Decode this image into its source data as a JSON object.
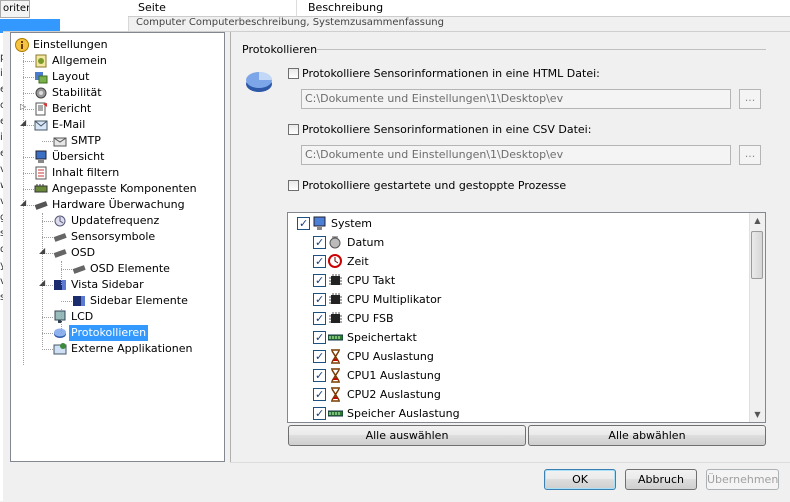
{
  "background": {
    "tab_label": "oriten",
    "columns": [
      "Seite",
      "Beschreibung"
    ],
    "row_text": "Computer                          Computerbeschreibung, Systemzusammenfassung",
    "letters": [
      "p",
      "i",
      "e",
      "c",
      "e",
      "i",
      "e",
      "v",
      "w",
      "v",
      "g",
      "s",
      "d",
      "y",
      "v",
      "s"
    ]
  },
  "tree": [
    {
      "label": "Einstellungen",
      "icon": "info-icon",
      "level": 0
    },
    {
      "label": "Allgemein",
      "icon": "general-settings-icon",
      "level": 1
    },
    {
      "label": "Layout",
      "icon": "layout-icon",
      "level": 1
    },
    {
      "label": "Stabilität",
      "icon": "stability-icon",
      "level": 1
    },
    {
      "label": "Bericht",
      "icon": "report-icon",
      "level": 1
    },
    {
      "label": "E-Mail",
      "icon": "email-icon",
      "level": 1
    },
    {
      "label": "SMTP",
      "icon": "smtp-icon",
      "level": 2
    },
    {
      "label": "Übersicht",
      "icon": "overview-icon",
      "level": 1
    },
    {
      "label": "Inhalt filtern",
      "icon": "filter-icon",
      "level": 1
    },
    {
      "label": "Angepasste Komponenten",
      "icon": "components-icon",
      "level": 1
    },
    {
      "label": "Hardware Überwachung",
      "icon": "hardware-icon",
      "level": 1
    },
    {
      "label": "Updatefrequenz",
      "icon": "update-frequency-icon",
      "level": 2
    },
    {
      "label": "Sensorsymbole",
      "icon": "sensor-icon",
      "level": 2
    },
    {
      "label": "OSD",
      "icon": "osd-icon",
      "level": 2
    },
    {
      "label": "OSD Elemente",
      "icon": "osd-elements-icon",
      "level": 3
    },
    {
      "label": "Vista Sidebar",
      "icon": "vista-sidebar-icon",
      "level": 2
    },
    {
      "label": "Sidebar Elemente",
      "icon": "sidebar-elements-icon",
      "level": 3
    },
    {
      "label": "LCD",
      "icon": "lcd-icon",
      "level": 2
    },
    {
      "label": "Protokollieren",
      "icon": "logging-icon",
      "level": 2,
      "selected": true
    },
    {
      "label": "Externe Applikationen",
      "icon": "external-apps-icon",
      "level": 2
    }
  ],
  "panel": {
    "title": "Protokollieren",
    "html_option": {
      "label": "Protokolliere Sensorinformationen in eine HTML Datei:",
      "checked": false,
      "path": "C:\\Dokumente und Einstellungen\\1\\Desktop\\ev",
      "browse": "..."
    },
    "csv_option": {
      "label": "Protokolliere Sensorinformationen in eine CSV Datei:",
      "checked": false,
      "path": "C:\\Dokumente und Einstellungen\\1\\Desktop\\ev",
      "browse": "..."
    },
    "process_option": {
      "label": "Protokolliere gestartete und gestoppte Prozesse",
      "checked": false
    }
  },
  "sensor_list": [
    {
      "label": "System",
      "icon": "computer-icon",
      "checked": true,
      "level": 0
    },
    {
      "label": "Datum",
      "icon": "date-icon",
      "checked": true,
      "level": 1
    },
    {
      "label": "Zeit",
      "icon": "clock-icon",
      "checked": true,
      "level": 1
    },
    {
      "label": "CPU Takt",
      "icon": "cpu-icon",
      "checked": true,
      "level": 1
    },
    {
      "label": "CPU Multiplikator",
      "icon": "cpu-icon",
      "checked": true,
      "level": 1
    },
    {
      "label": "CPU FSB",
      "icon": "cpu-icon",
      "checked": true,
      "level": 1
    },
    {
      "label": "Speichertakt",
      "icon": "memory-icon",
      "checked": true,
      "level": 1
    },
    {
      "label": "CPU Auslastung",
      "icon": "hourglass-icon",
      "checked": true,
      "level": 1
    },
    {
      "label": "CPU1 Auslastung",
      "icon": "hourglass-icon",
      "checked": true,
      "level": 1
    },
    {
      "label": "CPU2 Auslastung",
      "icon": "hourglass-icon",
      "checked": true,
      "level": 1
    },
    {
      "label": "Speicher Auslastung",
      "icon": "memory-icon",
      "checked": true,
      "level": 1
    }
  ],
  "buttons": {
    "select_all": "Alle auswählen",
    "deselect_all": "Alle abwählen",
    "ok": "OK",
    "cancel": "Abbruch",
    "apply": "Übernehmen"
  }
}
